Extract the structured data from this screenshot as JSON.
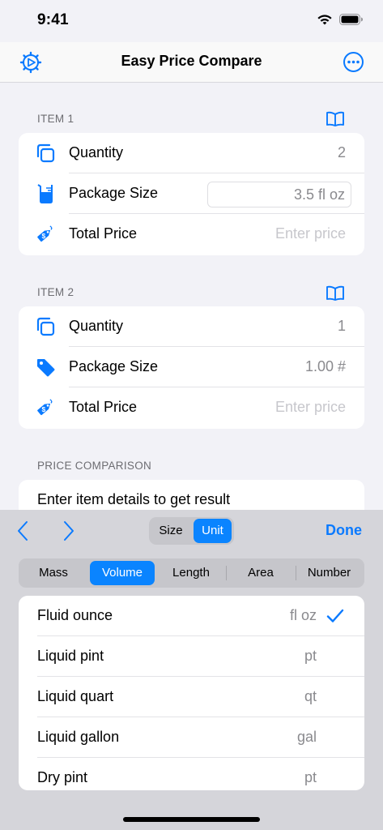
{
  "status": {
    "time": "9:41"
  },
  "nav": {
    "title": "Easy Price Compare"
  },
  "item1": {
    "header": "ITEM 1",
    "quantity_label": "Quantity",
    "quantity_value": "2",
    "package_label": "Package Size",
    "package_value": "3.5 fl oz",
    "price_label": "Total Price",
    "price_placeholder": "Enter price"
  },
  "item2": {
    "header": "ITEM 2",
    "quantity_label": "Quantity",
    "quantity_value": "1",
    "package_label": "Package Size",
    "package_value": "1.00 #",
    "price_label": "Total Price",
    "price_placeholder": "Enter price"
  },
  "comparison": {
    "header": "PRICE COMPARISON",
    "result": "Enter item details to get result"
  },
  "keyboard": {
    "mode_segments": [
      "Size",
      "Unit"
    ],
    "selected_mode": "Unit",
    "done_label": "Done",
    "unit_types": [
      "Mass",
      "Volume",
      "Length",
      "Area",
      "Number"
    ],
    "selected_type": "Volume",
    "units": [
      {
        "name": "Fluid ounce",
        "abbr": "fl oz",
        "selected": true
      },
      {
        "name": "Liquid pint",
        "abbr": "pt",
        "selected": false
      },
      {
        "name": "Liquid quart",
        "abbr": "qt",
        "selected": false
      },
      {
        "name": "Liquid gallon",
        "abbr": "gal",
        "selected": false
      },
      {
        "name": "Dry pint",
        "abbr": "pt",
        "selected": false
      }
    ]
  },
  "icons": {
    "settings": "gear-play-icon",
    "more": "ellipsis-circle-icon",
    "book": "book-icon",
    "quantity": "stack-squares-icon",
    "package_item1": "beaker-icon",
    "package_item2": "tag-icon",
    "price": "price-tag-dollar-icon",
    "check": "checkmark-icon"
  },
  "colors": {
    "accent": "#0a84ff",
    "background": "#f2f2f7",
    "keyboard": "#d5d5da"
  }
}
